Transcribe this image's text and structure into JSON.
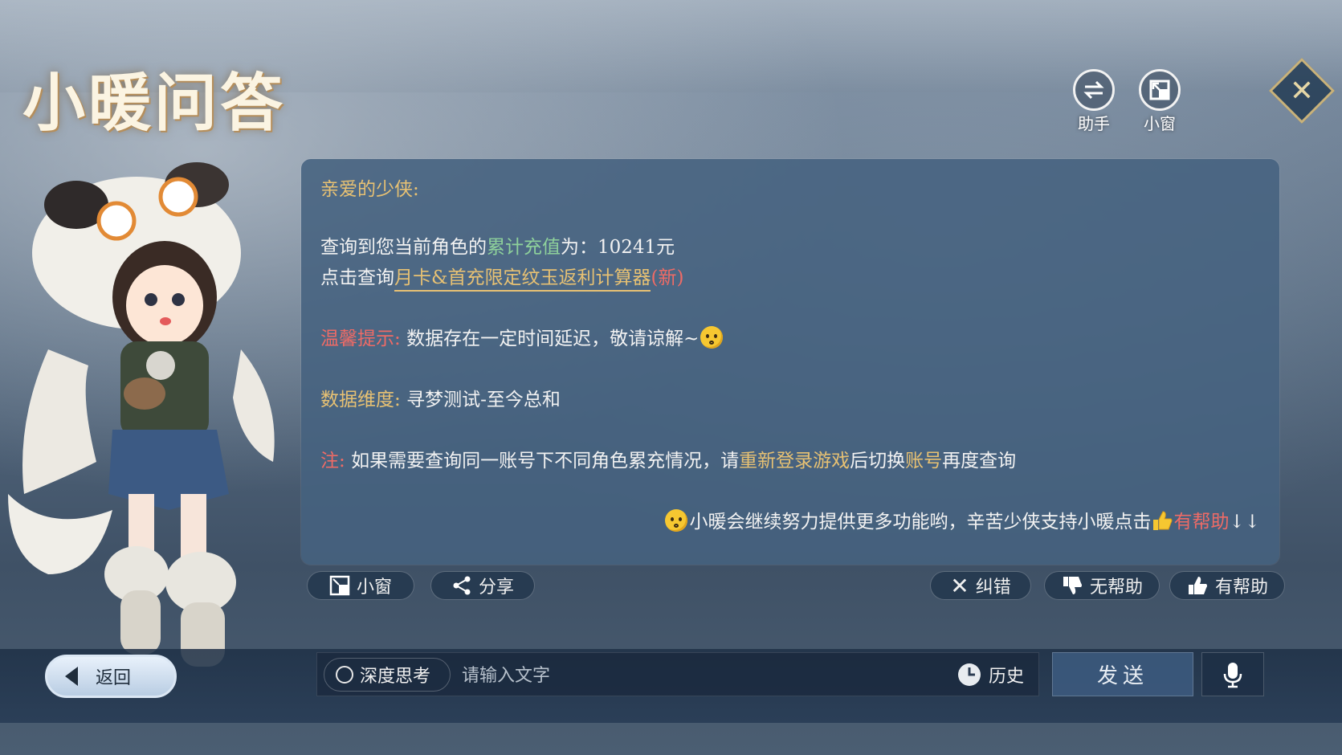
{
  "header": {
    "title": "小暖问答",
    "assistant_label": "助手",
    "mini_window_label": "小窗"
  },
  "message": {
    "greeting": "亲爱的少侠:",
    "query_prefix": "查询到您当前角色的",
    "query_highlight": "累计充值",
    "query_suffix": "为：10241元",
    "click_prefix": "点击查询",
    "calculator_link": "月卡&首充限定纹玉返利计算器",
    "new_tag": "(新)",
    "tip_label": "温馨提示:",
    "tip_text": "数据存在一定时间延迟，敬请谅解~",
    "dimension_label": "数据维度:",
    "dimension_text": "寻梦测试-至今总和",
    "note_label": "注:",
    "note_text_1": "如果需要查询同一账号下不同角色累充情况，请",
    "note_link_1": "重新登录游戏",
    "note_text_2": "后切换",
    "note_link_2": "账号",
    "note_text_3": "再度查询",
    "footer_text": "小暖会继续努力提供更多功能哟，辛苦少侠支持小暖点击",
    "footer_helpful": "有帮助",
    "footer_arrows": "↓↓"
  },
  "actions": {
    "mini_window": "小窗",
    "share": "分享",
    "correct": "纠错",
    "not_helpful": "无帮助",
    "helpful": "有帮助"
  },
  "bottom": {
    "back": "返回",
    "deep_think": "深度思考",
    "input_placeholder": "请输入文字",
    "history": "历史",
    "send": "发送"
  },
  "colors": {
    "gold": "#e7c173",
    "green": "#8ed19b",
    "red": "#ef6b66",
    "card_bg": "#46627f"
  }
}
